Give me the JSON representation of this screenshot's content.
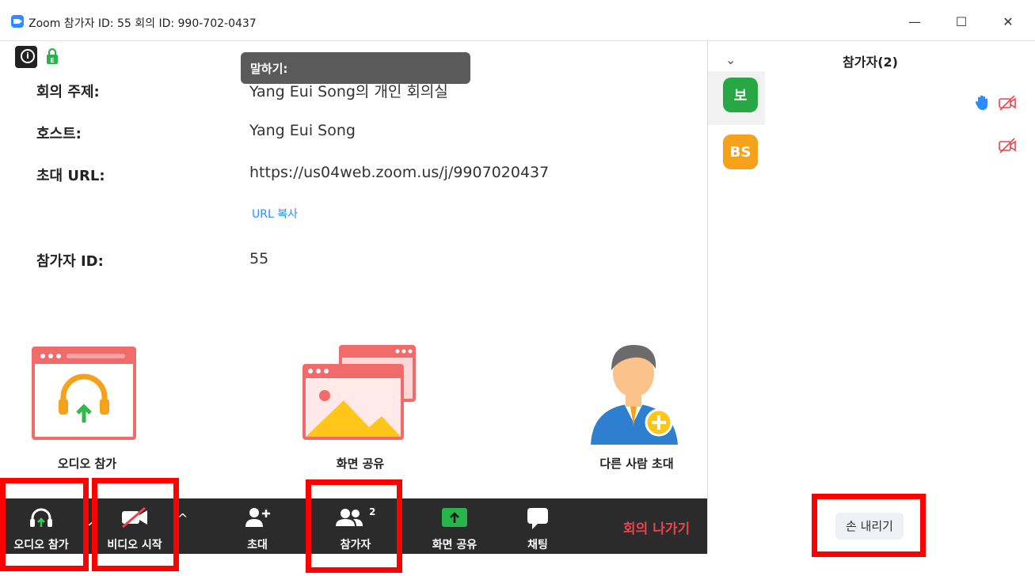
{
  "window": {
    "title": "Zoom 참가자 ID: 55   회의 ID: 990-702-0437",
    "minimize": "—",
    "maximize": "☐",
    "close": "✕"
  },
  "tooltip": {
    "text": "말하기:"
  },
  "meeting_info": {
    "topic_label": "회의 주제:",
    "topic_value": "Yang Eui Song의 개인 회의실",
    "host_label": "호스트:",
    "host_value": "Yang Eui Song",
    "url_label": "초대 URL:",
    "url_value": "https://us04web.zoom.us/j/9907020437",
    "copy_url": "URL 복사",
    "participant_id_label": "참가자 ID:",
    "participant_id_value": "55"
  },
  "big_actions": {
    "join_audio": "오디오 참가",
    "share_screen": "화면 공유",
    "invite_others": "다른 사람 초대"
  },
  "toolbar": {
    "audio": "오디오 참가",
    "video": "비디오 시작",
    "invite": "초대",
    "participants": "참가자",
    "participants_count": "2",
    "share": "화면 공유",
    "chat": "채팅",
    "leave": "회의 나가기",
    "caret": "^"
  },
  "participants_panel": {
    "title": "참가자(2)",
    "chevron": "⌄",
    "participants": [
      {
        "avatar_text": "보",
        "avatar_color": "#27a844",
        "hand_raised": true
      },
      {
        "avatar_text": "BS",
        "avatar_color": "#f5a11c",
        "hand_raised": false
      }
    ],
    "lower_hand": "손 내리기"
  },
  "colors": {
    "accent": "#2d8cff",
    "leave": "#e8454f",
    "highlight_box": "#ff0000",
    "toolbar_bg": "#2b2b2b"
  }
}
